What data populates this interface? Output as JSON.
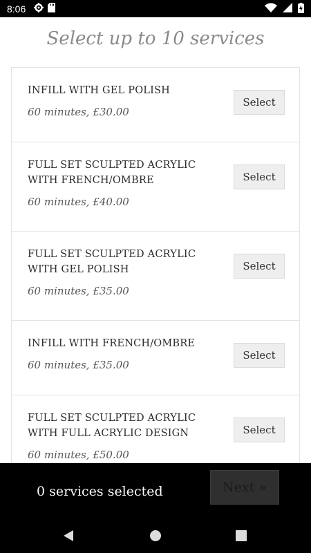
{
  "status_bar": {
    "time": "8:06",
    "icons_left": [
      "gear-icon",
      "sd-card-icon"
    ],
    "icons_right": [
      "wifi-icon",
      "signal-icon",
      "battery-charging-icon"
    ]
  },
  "page": {
    "title": "Select up to 10 services"
  },
  "services": [
    {
      "name": "INFILL WITH GEL POLISH",
      "meta": "60 minutes, £30.00",
      "button": "Select"
    },
    {
      "name": "FULL SET SCULPTED ACRYLIC WITH FRENCH/OMBRE",
      "meta": "60 minutes, £40.00",
      "button": "Select"
    },
    {
      "name": "FULL SET SCULPTED ACRYLIC WITH GEL POLISH",
      "meta": "60 minutes, £35.00",
      "button": "Select"
    },
    {
      "name": "INFILL WITH FRENCH/OMBRE",
      "meta": "60 minutes, £35.00",
      "button": "Select"
    },
    {
      "name": "FULL SET SCULPTED ACRYLIC WITH FULL ACRYLIC DESIGN",
      "meta": "60 minutes, £50.00",
      "button": "Select"
    }
  ],
  "footer": {
    "selected_count": "0 services selected",
    "next_label": "Next »"
  },
  "nav": {
    "icons": [
      "back-icon",
      "home-icon",
      "recents-icon"
    ]
  },
  "colors": {
    "title": "#8a8a8a",
    "button_bg": "#eeeeee",
    "bar_bg": "#000000"
  }
}
